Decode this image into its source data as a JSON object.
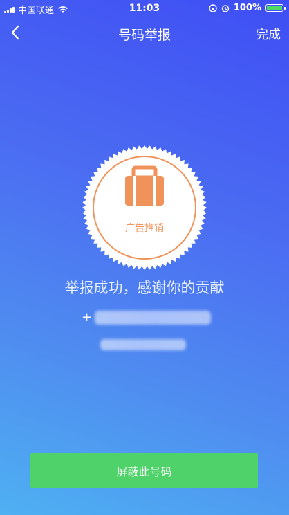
{
  "status_bar": {
    "carrier": "中国联通",
    "time": "11:03",
    "battery": "100%",
    "battery_fill": 1.0
  },
  "nav": {
    "title": "号码举报",
    "done_label": "完成",
    "back_icon": "chevron-left-icon"
  },
  "badge": {
    "label": "广告推销",
    "icon": "briefcase-icon",
    "accent_color": "#f0935a"
  },
  "result": {
    "message": "举报成功，感谢你的贡献",
    "number_prefix": "+"
  },
  "actions": {
    "block_label": "屏蔽此号码",
    "block_color": "#4fd26a"
  }
}
